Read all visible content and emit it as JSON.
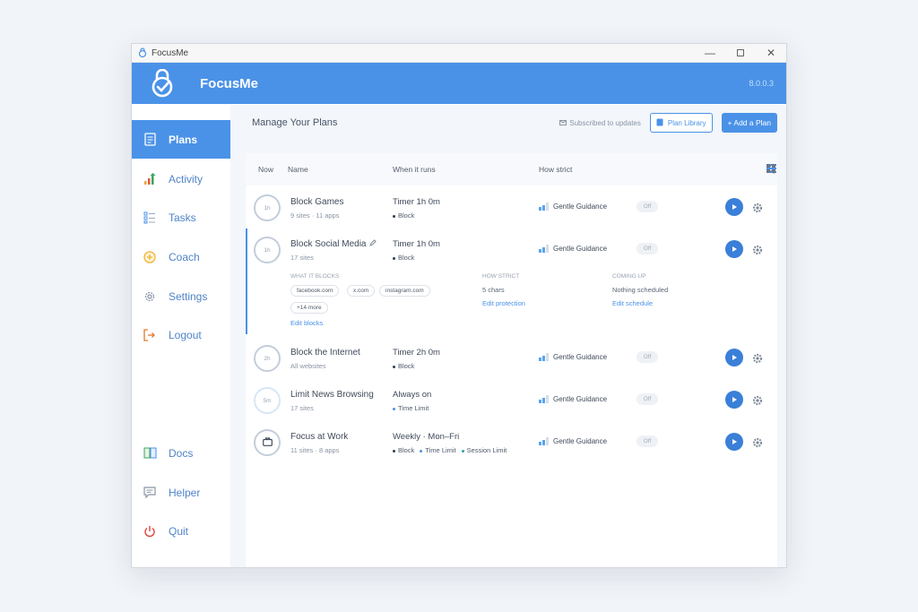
{
  "window": {
    "title": "FocusMe",
    "controls": [
      "minimize",
      "maximize",
      "close"
    ]
  },
  "header": {
    "app_name": "FocusMe",
    "version": "8.0.0.3"
  },
  "sidebar": {
    "items": [
      {
        "label": "Plans",
        "icon": "document-icon",
        "active": true
      },
      {
        "label": "Activity",
        "icon": "bar-chart-icon"
      },
      {
        "label": "Tasks",
        "icon": "task-list-icon"
      },
      {
        "label": "Coach",
        "icon": "coach-plus-icon"
      },
      {
        "label": "Settings",
        "icon": "gear-icon"
      },
      {
        "label": "Logout",
        "icon": "logout-icon"
      }
    ],
    "bottom_items": [
      {
        "label": "Docs",
        "icon": "book-icon"
      },
      {
        "label": "Helper",
        "icon": "chat-icon"
      },
      {
        "label": "Quit",
        "icon": "power-icon"
      }
    ]
  },
  "toolbar": {
    "title": "Manage Your Plans",
    "subscribed": "Subscribed to updates",
    "plan_library": "Plan Library",
    "add_plan": "+ Add a Plan"
  },
  "table": {
    "headers": {
      "now": "Now",
      "name": "Name",
      "when": "When it runs",
      "strict": "How strict"
    },
    "rows": [
      {
        "badge": "1h",
        "name": "Block Games",
        "sub": "9 sites · 11 apps",
        "when": "Timer 1h 0m",
        "modes": [
          "Block"
        ],
        "strict": "Gentle Guidance",
        "toggle": "Off"
      },
      {
        "badge": "1h",
        "name": "Block Social Media",
        "sub": "17 sites",
        "when": "Timer 1h 0m",
        "modes": [
          "Block"
        ],
        "strict": "Gentle Guidance",
        "toggle": "Off"
      },
      {
        "badge": "2h",
        "name": "Block the Internet",
        "sub": "All websites",
        "when": "Timer 2h 0m",
        "modes": [
          "Block"
        ],
        "strict": "Gentle Guidance",
        "toggle": "Off"
      },
      {
        "badge": "5m",
        "name": "Limit News Browsing",
        "sub": "17 sites",
        "when": "Always on",
        "modes": [
          "Time Limit"
        ],
        "strict": "Gentle Guidance",
        "toggle": "Off"
      },
      {
        "badge": "",
        "name": "Focus at Work",
        "sub": "11 sites · 8 apps",
        "when": "Weekly · Mon–Fri",
        "modes": [
          "Block",
          "Time Limit",
          "Session Limit"
        ],
        "strict": "Gentle Guidance",
        "toggle": "Off"
      }
    ]
  },
  "details": {
    "what_it_blocks": "WHAT IT BLOCKS",
    "chips": [
      "facebook.com",
      "x.com",
      "instagram.com",
      "+14 more"
    ],
    "edit_blocks": "Edit blocks",
    "how_strict": "HOW STRICT",
    "strict_value": "5 chars",
    "edit_protection": "Edit protection",
    "coming_up": "COMING UP",
    "coming_value": "Nothing scheduled",
    "edit_schedule": "Edit schedule"
  },
  "colors": {
    "accent": "#4a92e8",
    "play": "#3a7fd8"
  }
}
